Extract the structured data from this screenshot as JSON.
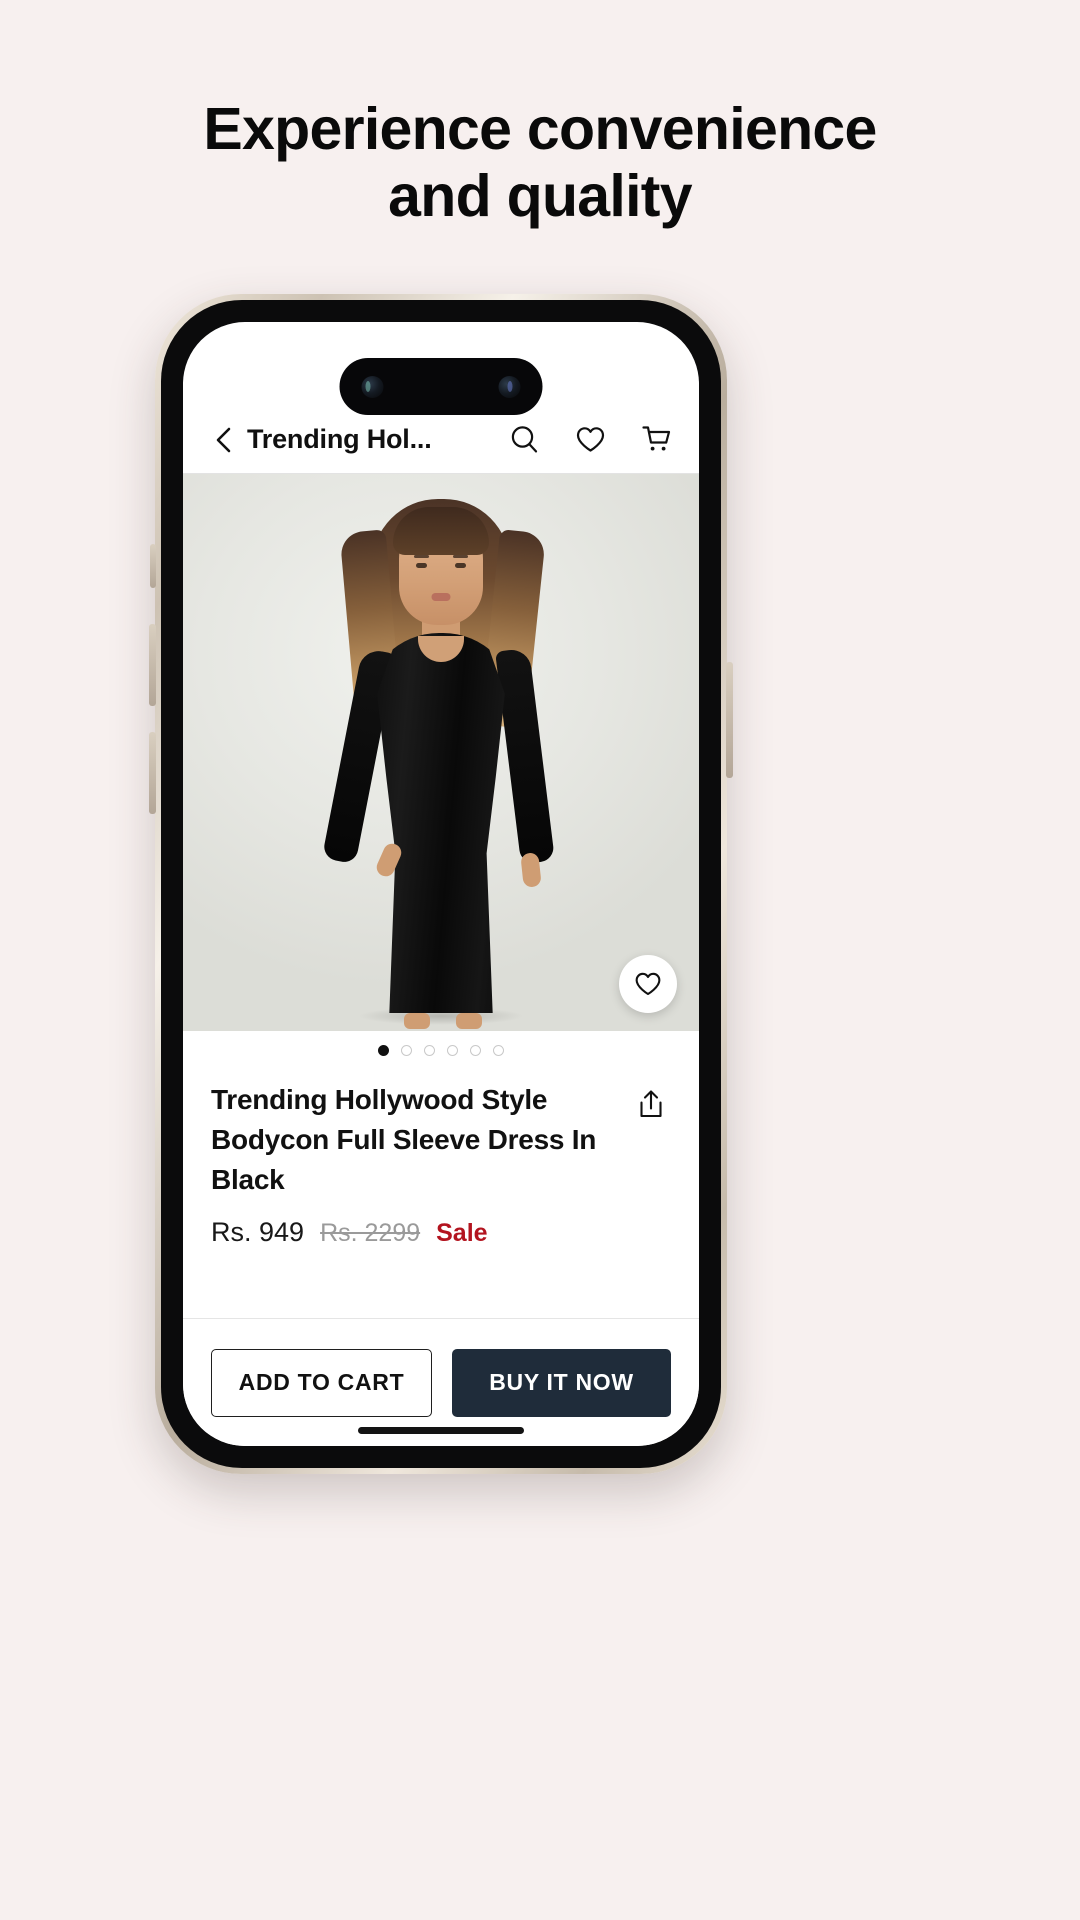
{
  "page": {
    "background_color": "#f7f0ef",
    "headline_line1": "Experience convenience",
    "headline_line2": "and quality"
  },
  "app": {
    "nav": {
      "back_icon": "chevron-left-icon",
      "title": "Trending Hol...",
      "actions": [
        {
          "icon": "search-icon",
          "label": "Search"
        },
        {
          "icon": "heart-icon",
          "label": "Wishlist"
        },
        {
          "icon": "cart-icon",
          "label": "Cart"
        }
      ]
    },
    "gallery": {
      "wishlist_fab_icon": "heart-icon",
      "dots_total": 6,
      "dots_active_index": 0
    },
    "product": {
      "title": "Trending Hollywood Style Bodycon Full Sleeve Dress In Black",
      "share_icon": "share-icon",
      "price_current": "Rs. 949",
      "price_compare": "Rs. 2299",
      "sale_badge": "Sale",
      "sale_color": "#b3141f"
    },
    "cta": {
      "add_to_cart_label": "ADD TO CART",
      "buy_now_label": "BUY IT NOW",
      "buy_now_color": "#1f2c3a"
    }
  }
}
